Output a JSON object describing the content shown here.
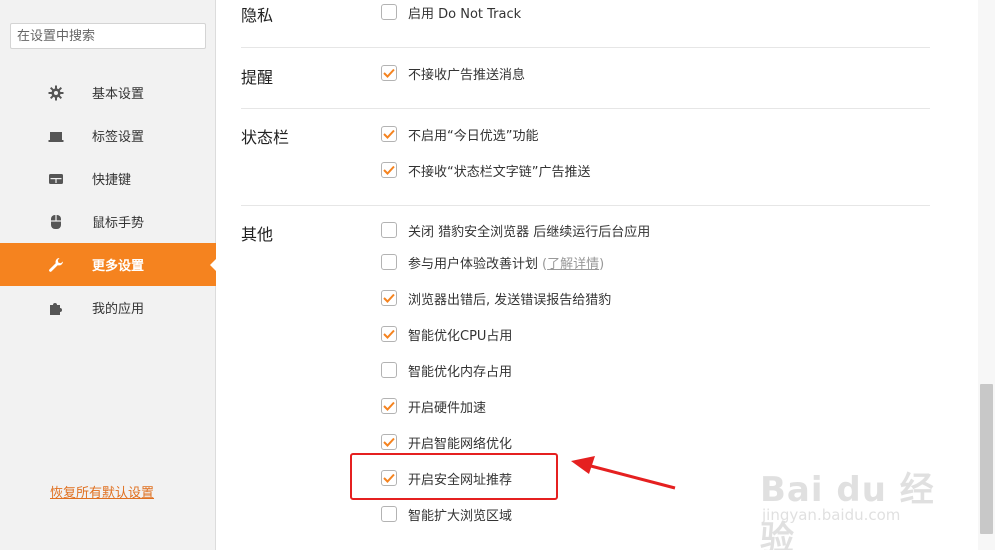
{
  "sidebar": {
    "search_placeholder": "在设置中搜索",
    "items": [
      {
        "label": "基本设置",
        "icon": "gear-icon"
      },
      {
        "label": "标签设置",
        "icon": "tab-icon"
      },
      {
        "label": "快捷键",
        "icon": "keyboard-icon"
      },
      {
        "label": "鼠标手势",
        "icon": "mouse-icon"
      },
      {
        "label": "更多设置",
        "icon": "wrench-icon",
        "active": true
      },
      {
        "label": "我的应用",
        "icon": "puzzle-icon"
      }
    ],
    "restore_label": "恢复所有默认设置"
  },
  "sections": {
    "privacy": {
      "label": "隐私",
      "options": [
        {
          "text": "启用 Do Not Track",
          "checked": false
        }
      ]
    },
    "reminder": {
      "label": "提醒",
      "options": [
        {
          "text": "不接收广告推送消息",
          "checked": true
        }
      ]
    },
    "statusbar": {
      "label": "状态栏",
      "options": [
        {
          "text": "不启用“今日优选”功能",
          "checked": true
        },
        {
          "text": "不接收“状态栏文字链”广告推送",
          "checked": true
        }
      ]
    },
    "other": {
      "label": "其他",
      "options": [
        {
          "text": "关闭 猎豹安全浏览器 后继续运行后台应用",
          "checked": false
        },
        {
          "text": "参与用户体验改善计划",
          "checked": false,
          "extra_open": "(",
          "extra_link": "了解详情",
          "extra_close": ")"
        },
        {
          "text": "浏览器出错后, 发送错误报告给猎豹",
          "checked": true
        },
        {
          "text": "智能优化CPU占用",
          "checked": true
        },
        {
          "text": "智能优化内存占用",
          "checked": false
        },
        {
          "text": "开启硬件加速",
          "checked": true
        },
        {
          "text": "开启智能网络优化",
          "checked": true
        },
        {
          "text": "开启安全网址推荐",
          "checked": true
        },
        {
          "text": "智能扩大浏览区域",
          "checked": false
        }
      ]
    }
  },
  "watermark": {
    "main": "Bai du 经验",
    "sub": "jingyan.baidu.com"
  },
  "colors": {
    "accent": "#f5831f",
    "check": "#f5831f",
    "annotation": "#e52020"
  }
}
